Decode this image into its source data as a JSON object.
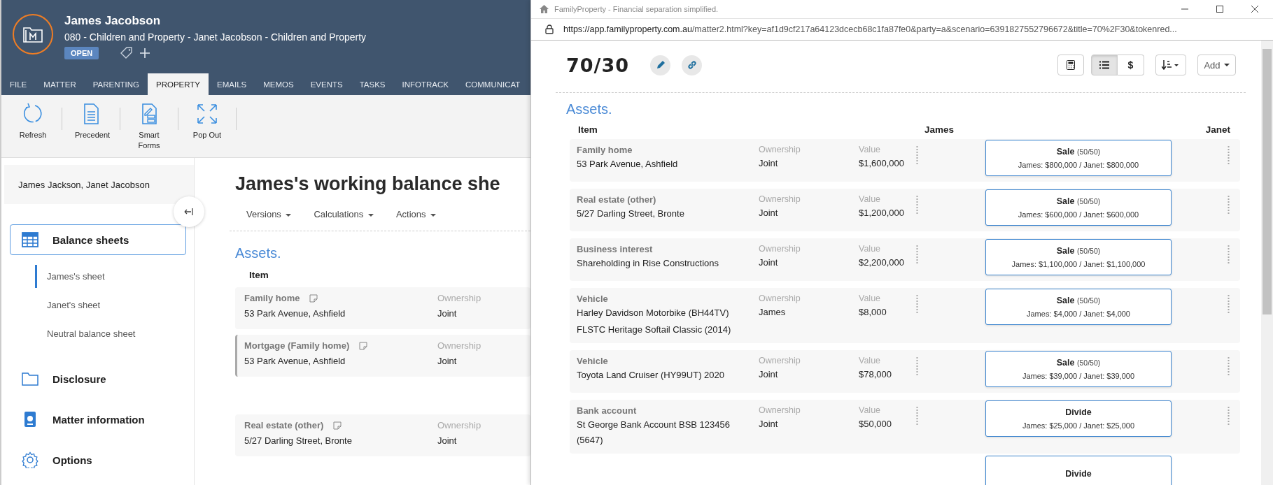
{
  "app": {
    "matter_title": "James Jacobson",
    "matter_subtitle": "080 - Children and Property - Janet Jacobson - Children and Property",
    "status": "OPEN",
    "tabs": [
      {
        "label": "FILE",
        "selected": false
      },
      {
        "label": "MATTER",
        "selected": false
      },
      {
        "label": "PARENTING",
        "selected": false
      },
      {
        "label": "PROPERTY",
        "selected": true
      },
      {
        "label": "EMAILS",
        "selected": false
      },
      {
        "label": "MEMOS",
        "selected": false
      },
      {
        "label": "EVENTS",
        "selected": false
      },
      {
        "label": "TASKS",
        "selected": false
      },
      {
        "label": "INFOTRACK",
        "selected": false
      },
      {
        "label": "COMMUNICAT",
        "selected": false
      }
    ],
    "toolbar": [
      {
        "label": "Refresh",
        "kind": "refresh"
      },
      {
        "label": "Precedent",
        "kind": "document"
      },
      {
        "label": "Smart Forms",
        "kind": "form"
      },
      {
        "label": "Pop Out",
        "kind": "expand"
      }
    ]
  },
  "sidebar": {
    "parties": "James Jackson, Janet Jacobson",
    "nav": [
      {
        "label": "Balance sheets",
        "kind": "grid",
        "selected": true,
        "children": [
          {
            "label": "James's sheet",
            "selected": true
          },
          {
            "label": "Janet's sheet",
            "selected": false
          },
          {
            "label": "Neutral balance sheet",
            "selected": false
          }
        ]
      },
      {
        "label": "Disclosure",
        "kind": "folder",
        "selected": false
      },
      {
        "label": "Matter information",
        "kind": "badge",
        "selected": false
      },
      {
        "label": "Options",
        "kind": "gear",
        "selected": false
      }
    ]
  },
  "main": {
    "title": "James's working balance she",
    "menus": [
      "Versions",
      "Calculations",
      "Actions"
    ],
    "section": "Assets.",
    "column": "Item",
    "rows": [
      {
        "title": "Family home",
        "detail": "53 Park Avenue, Ashfield",
        "ownership_label": "Ownership",
        "ownership": "Joint",
        "highlighted": false
      },
      {
        "title": "Mortgage (Family home)",
        "detail": "53 Park Avenue, Ashfield",
        "ownership_label": "Ownership",
        "ownership": "Joint",
        "highlighted": true
      },
      {
        "title": "Real estate (other)",
        "detail": "5/27 Darling Street, Bronte",
        "ownership_label": "Ownership",
        "ownership": "Joint",
        "highlighted": false
      }
    ]
  },
  "popup": {
    "window_title": "FamilyProperty - Financial separation simplified.",
    "url_host": "https://app.familyproperty.com.au",
    "url_rest": "/matter2.html?key=af1d9cf217a64123dcecb68c1fa87fe0&party=a&scenario=6391827552796672&title=70%2F30&tokenred...",
    "scenario_title": "70/30",
    "view_buttons": [
      {
        "kind": "calculator",
        "selected": false
      },
      {
        "kind": "list",
        "selected": true
      },
      {
        "kind": "text",
        "label": "$",
        "selected": false
      }
    ],
    "add_button": "Add",
    "section": "Assets.",
    "columns": [
      "Item",
      "James",
      "Janet"
    ],
    "rows": [
      {
        "type": "Family home",
        "details": [
          "53 Park Avenue, Ashfield"
        ],
        "ownership_label": "Ownership",
        "ownership": "Joint",
        "value_label": "Value",
        "value": "$1,600,000",
        "decision": "Sale",
        "ratio": "(50/50)",
        "split": "James: $800,000 / Janet: $800,000"
      },
      {
        "type": "Real estate (other)",
        "details": [
          "5/27 Darling Street, Bronte"
        ],
        "ownership_label": "Ownership",
        "ownership": "Joint",
        "value_label": "Value",
        "value": "$1,200,000",
        "decision": "Sale",
        "ratio": "(50/50)",
        "split": "James: $600,000 / Janet: $600,000"
      },
      {
        "type": "Business interest",
        "details": [
          "Shareholding in Rise Constructions"
        ],
        "ownership_label": "Ownership",
        "ownership": "Joint",
        "value_label": "Value",
        "value": "$2,200,000",
        "decision": "Sale",
        "ratio": "(50/50)",
        "split": "James: $1,100,000 / Janet: $1,100,000"
      },
      {
        "type": "Vehicle",
        "details": [
          "Harley Davidson Motorbike (BH44TV)",
          "FLSTC Heritage Softail Classic (2014)"
        ],
        "ownership_label": "Ownership",
        "ownership": "James",
        "value_label": "Value",
        "value": "$8,000",
        "decision": "Sale",
        "ratio": "(50/50)",
        "split": "James: $4,000 / Janet: $4,000"
      },
      {
        "type": "Vehicle",
        "details": [
          "Toyota Land Cruiser (HY99UT) 2020"
        ],
        "ownership_label": "Ownership",
        "ownership": "Joint",
        "value_label": "Value",
        "value": "$78,000",
        "decision": "Sale",
        "ratio": "(50/50)",
        "split": "James: $39,000 / Janet: $39,000"
      },
      {
        "type": "Bank account",
        "details": [
          "St George Bank Account BSB 123456 (5647)"
        ],
        "ownership_label": "Ownership",
        "ownership": "Joint",
        "value_label": "Value",
        "value": "$50,000",
        "decision": "Divide",
        "split": "James: $25,000 / Janet: $25,000"
      },
      {
        "decision": "Divide"
      }
    ]
  }
}
